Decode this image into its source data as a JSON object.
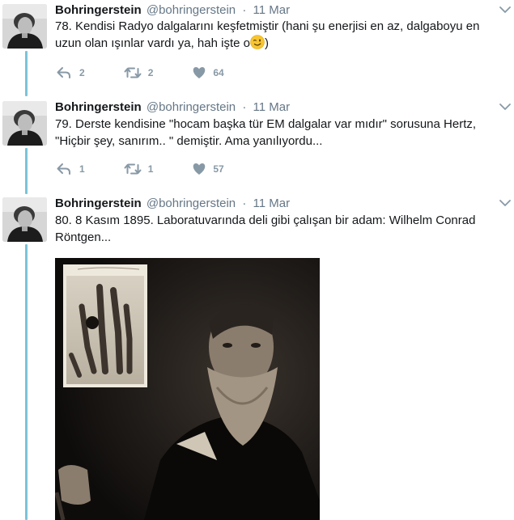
{
  "tweets": [
    {
      "name": "Bohringerstein",
      "handle": "@bohringerstein",
      "dot": "·",
      "time": "11 Mar",
      "text": "78. Kendisi Radyo dalgalarını keşfetmiştir (hani şu enerjisi en az, dalgaboyu en uzun olan ışınlar vardı ya, hah işte o",
      "text_after_emoji": ")",
      "emoji": "winking-face",
      "replies": "2",
      "retweets": "2",
      "likes": "64"
    },
    {
      "name": "Bohringerstein",
      "handle": "@bohringerstein",
      "dot": "·",
      "time": "11 Mar",
      "text": "79. Derste kendisine \"hocam başka tür EM dalgalar var mıdır\" sorusuna Hertz, \"Hiçbir şey, sanırım.. \" demiştir. Ama yanılıyordu...",
      "replies": "1",
      "retweets": "1",
      "likes": "57"
    },
    {
      "name": "Bohringerstein",
      "handle": "@bohringerstein",
      "dot": "·",
      "time": "11 Mar",
      "text": "80. 8 Kasım 1895. Laboratuvarında deli gibi çalışan bir adam: Wilhelm Conrad Röntgen..."
    }
  ],
  "icons": {
    "reply": "reply-icon",
    "retweet": "retweet-icon",
    "like": "heart-icon",
    "menu": "chevron-down-icon"
  },
  "colors": {
    "thread_line": "#7ac4d8",
    "muted": "#657786",
    "action": "#8899a6"
  }
}
